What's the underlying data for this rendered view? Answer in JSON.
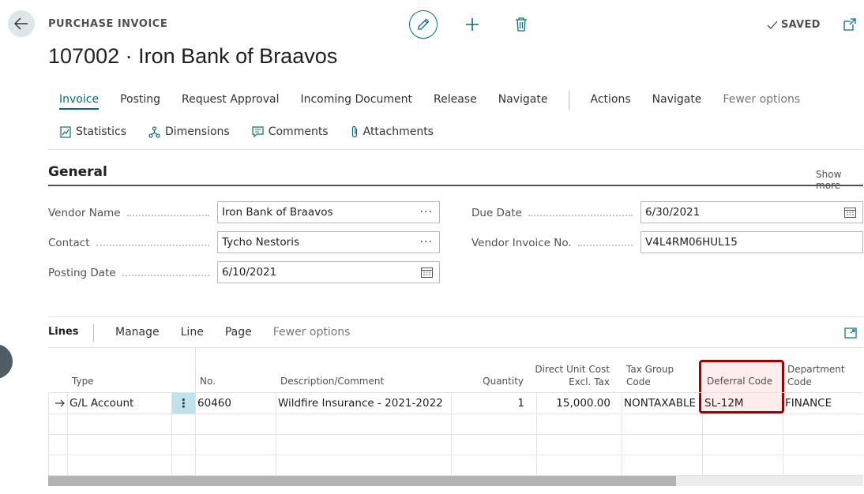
{
  "header": {
    "page_type": "PURCHASE INVOICE",
    "title": "107002 · Iron Bank of Braavos",
    "saved_label": "SAVED"
  },
  "menu": {
    "items": [
      {
        "label": "Invoice",
        "active": true
      },
      {
        "label": "Posting"
      },
      {
        "label": "Request Approval"
      },
      {
        "label": "Incoming Document"
      },
      {
        "label": "Release"
      },
      {
        "label": "Navigate"
      },
      {
        "label": "Actions"
      },
      {
        "label": "Navigate"
      },
      {
        "label": "Fewer options"
      }
    ],
    "sub_items": [
      {
        "label": "Statistics",
        "icon": "statistics-icon"
      },
      {
        "label": "Dimensions",
        "icon": "dimensions-icon"
      },
      {
        "label": "Comments",
        "icon": "comments-icon"
      },
      {
        "label": "Attachments",
        "icon": "attachment-icon"
      }
    ]
  },
  "general": {
    "title": "General",
    "show_more": "Show more",
    "vendor_name": {
      "label": "Vendor Name",
      "value": "Iron Bank of Braavos"
    },
    "contact": {
      "label": "Contact",
      "value": "Tycho Nestoris"
    },
    "posting_date": {
      "label": "Posting Date",
      "value": "6/10/2021"
    },
    "due_date": {
      "label": "Due Date",
      "value": "6/30/2021"
    },
    "vendor_invoice_no": {
      "label": "Vendor Invoice No.",
      "value": "V4L4RM06HUL15"
    }
  },
  "lines": {
    "title": "Lines",
    "menu": [
      "Manage",
      "Line",
      "Page",
      "Fewer options"
    ],
    "columns": {
      "type": "Type",
      "no": "No.",
      "description": "Description/Comment",
      "quantity": "Quantity",
      "direct_unit_cost_1": "Direct Unit Cost",
      "direct_unit_cost_2": "Excl. Tax",
      "tax_group_1": "Tax Group",
      "tax_group_2": "Code",
      "deferral_code": "Deferral Code",
      "department_1": "Department",
      "department_2": "Code"
    },
    "rows": [
      {
        "type": "G/L Account",
        "no": "60460",
        "description": "Wildfire Insurance - 2021-2022",
        "quantity": "1",
        "direct_unit_cost": "15,000.00",
        "tax_group": "NONTAXABLE",
        "deferral_code": "SL-12M",
        "department": "FINANCE"
      }
    ]
  },
  "colors": {
    "accent": "#00707a",
    "highlight_border": "#a00000",
    "selected_cell": "#bfe3ec"
  }
}
